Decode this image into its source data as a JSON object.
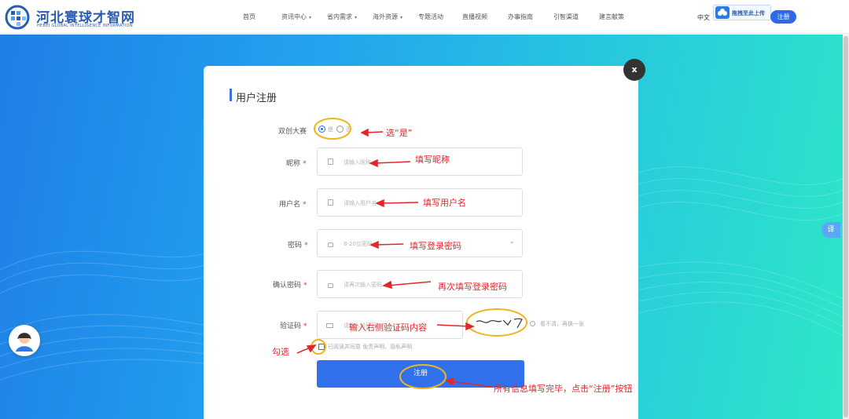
{
  "nav": {
    "logo_cn": "河北寰球才智网",
    "logo_en": "HEBEI GLOBAL INTELLIGENCE INFORMATION",
    "items": [
      "首页",
      "资讯中心",
      "省内需求",
      "海外资源",
      "专题活动",
      "直播视频",
      "办事指南",
      "引智渠道",
      "建言献策"
    ],
    "language": "中文",
    "upload_label": "拖拽至此上传",
    "register_label": "注册"
  },
  "form": {
    "title": "用户注册",
    "contest_label": "双创大赛",
    "contest_yes": "是",
    "contest_no": "否",
    "nickname_label": "昵称",
    "nickname_placeholder": "请输入昵称",
    "username_label": "用户名",
    "username_placeholder": "请输入用户名",
    "password_label": "密码",
    "password_placeholder": "8-20位密码",
    "confirm_label": "确认密码",
    "confirm_placeholder": "请再次输入密码",
    "captcha_label": "验证码",
    "captcha_placeholder": "请输入验证码",
    "captcha_refresh": "看不清，再换一张",
    "agree_text": "已阅读并同意 免责声明、隐私声明",
    "required_mark": "*",
    "submit_label": "注册",
    "close_label": "x"
  },
  "side": {
    "translate_label": "译"
  },
  "annotations": {
    "select_yes": "选“是”",
    "fill_nickname": "填写昵称",
    "fill_username": "填写用户名",
    "fill_password": "填写登录密码",
    "refill_password": "再次填写登录密码",
    "enter_captcha": "输入右侧验证码内容",
    "check": "勾选",
    "final_step": "所有信息填写完毕，点击“注册”按钮"
  },
  "colors": {
    "primary": "#3171ec",
    "annotation_red": "#e4262c",
    "highlight_yellow": "#f0b51e"
  }
}
